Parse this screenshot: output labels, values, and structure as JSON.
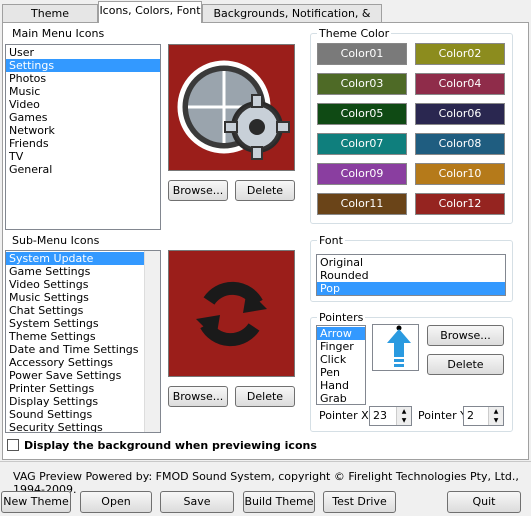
{
  "tabs": [
    {
      "label": "Theme Information"
    },
    {
      "label": "Icons, Colors, Font"
    },
    {
      "label": "Backgrounds, Notification, & Sounds"
    }
  ],
  "main_menu": {
    "title": "Main Menu Icons",
    "items": [
      "User",
      "Settings",
      "Photos",
      "Music",
      "Video",
      "Games",
      "Network",
      "Friends",
      "TV",
      "General"
    ],
    "selected_index": 1
  },
  "sub_menu": {
    "title": "Sub-Menu Icons",
    "items": [
      "System Update",
      "Game Settings",
      "Video Settings",
      "Music Settings",
      "Chat Settings",
      "System Settings",
      "Theme Settings",
      "Date and Time Settings",
      "Accessory Settings",
      "Power Save Settings",
      "Printer Settings",
      "Display Settings",
      "Sound Settings",
      "Security Settings"
    ],
    "selected_index": 0
  },
  "buttons": {
    "browse": "Browse...",
    "delete": "Delete"
  },
  "theme_color": {
    "title": "Theme Color",
    "colors": [
      {
        "label": "Color01",
        "hex": "#7a7a7a"
      },
      {
        "label": "Color02",
        "hex": "#8c8c1e"
      },
      {
        "label": "Color03",
        "hex": "#4e6a26"
      },
      {
        "label": "Color04",
        "hex": "#8f2c4a"
      },
      {
        "label": "Color05",
        "hex": "#0f4a14"
      },
      {
        "label": "Color06",
        "hex": "#2a2750"
      },
      {
        "label": "Color07",
        "hex": "#0f7f7d"
      },
      {
        "label": "Color08",
        "hex": "#1f5d80"
      },
      {
        "label": "Color09",
        "hex": "#8a3ea0"
      },
      {
        "label": "Color10",
        "hex": "#b57a1a"
      },
      {
        "label": "Color11",
        "hex": "#6a4418"
      },
      {
        "label": "Color12",
        "hex": "#952420"
      }
    ]
  },
  "font": {
    "title": "Font",
    "items": [
      "Original",
      "Rounded",
      "Pop"
    ],
    "selected_index": 2
  },
  "pointers": {
    "title": "Pointers",
    "items": [
      "Arrow",
      "Finger",
      "Click",
      "Pen",
      "Hand",
      "Grab"
    ],
    "selected_index": 0,
    "pointer_x_label": "Pointer X",
    "pointer_x_value": "23",
    "pointer_y_label": "Pointer Y",
    "pointer_y_value": "2"
  },
  "checkbox": {
    "label": "Display the background when previewing icons",
    "checked": false
  },
  "footer": {
    "text": "VAG Preview Powered by: FMOD Sound System, copyright © Firelight Technologies Pty, Ltd., 1994-2009."
  },
  "bottom_buttons": {
    "new_theme": "New Theme",
    "open": "Open",
    "save": "Save",
    "build_theme": "Build Theme",
    "test_drive": "Test Drive",
    "quit": "Quit"
  },
  "preview_bg": "#9b1e1a",
  "accent": "#3399ff"
}
